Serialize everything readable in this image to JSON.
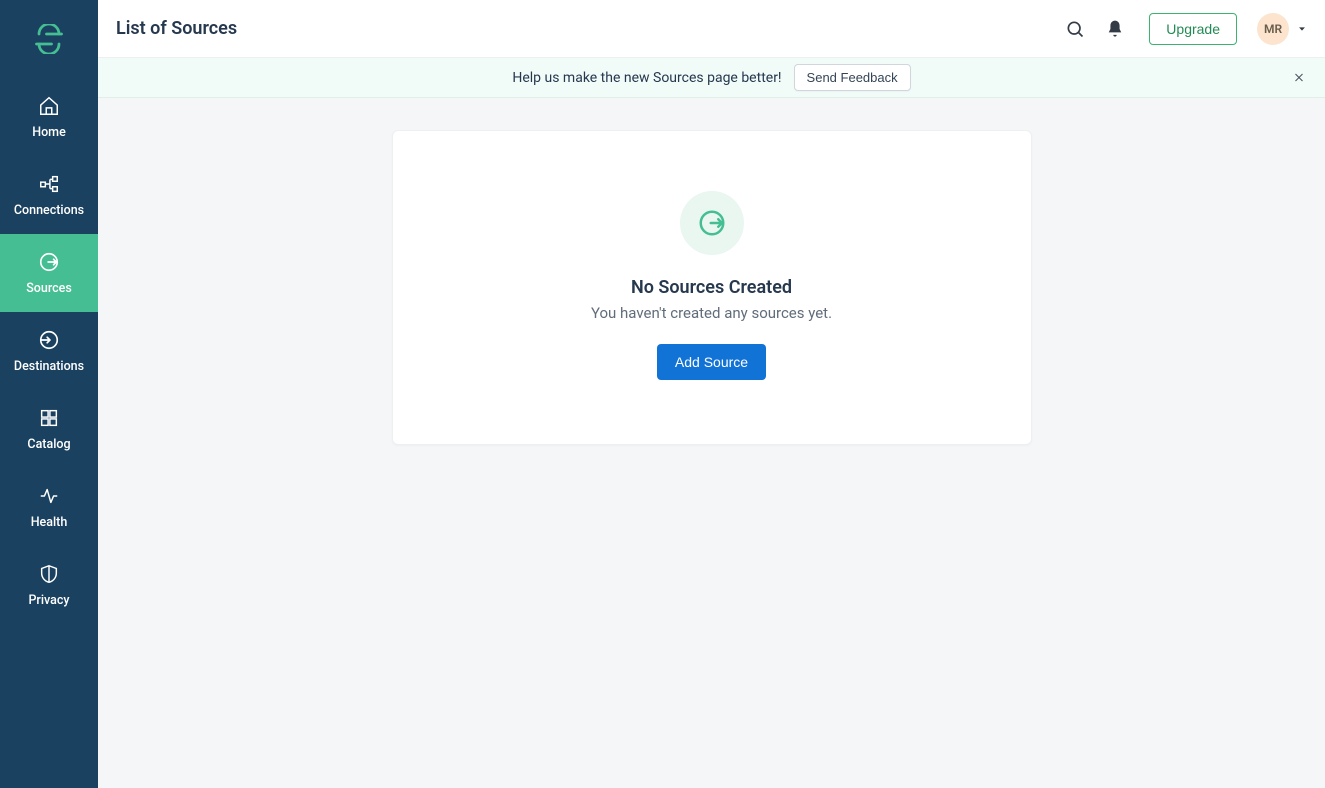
{
  "sidebar": {
    "items": [
      {
        "label": "Home",
        "icon": "home-icon",
        "active": false
      },
      {
        "label": "Connections",
        "icon": "connections-icon",
        "active": false
      },
      {
        "label": "Sources",
        "icon": "sources-icon",
        "active": true
      },
      {
        "label": "Destinations",
        "icon": "destinations-icon",
        "active": false
      },
      {
        "label": "Catalog",
        "icon": "catalog-icon",
        "active": false
      },
      {
        "label": "Health",
        "icon": "health-icon",
        "active": false
      },
      {
        "label": "Privacy",
        "icon": "privacy-icon",
        "active": false
      }
    ]
  },
  "header": {
    "title": "List of Sources",
    "upgrade_label": "Upgrade",
    "avatar_initials": "MR"
  },
  "banner": {
    "text": "Help us make the new Sources page better!",
    "button_label": "Send Feedback"
  },
  "empty_state": {
    "title": "No Sources Created",
    "subtitle": "You haven't created any sources yet.",
    "cta_label": "Add Source"
  },
  "colors": {
    "sidebar_bg": "#1b4160",
    "active_bg": "#45be93",
    "primary_btn": "#1273d6"
  }
}
